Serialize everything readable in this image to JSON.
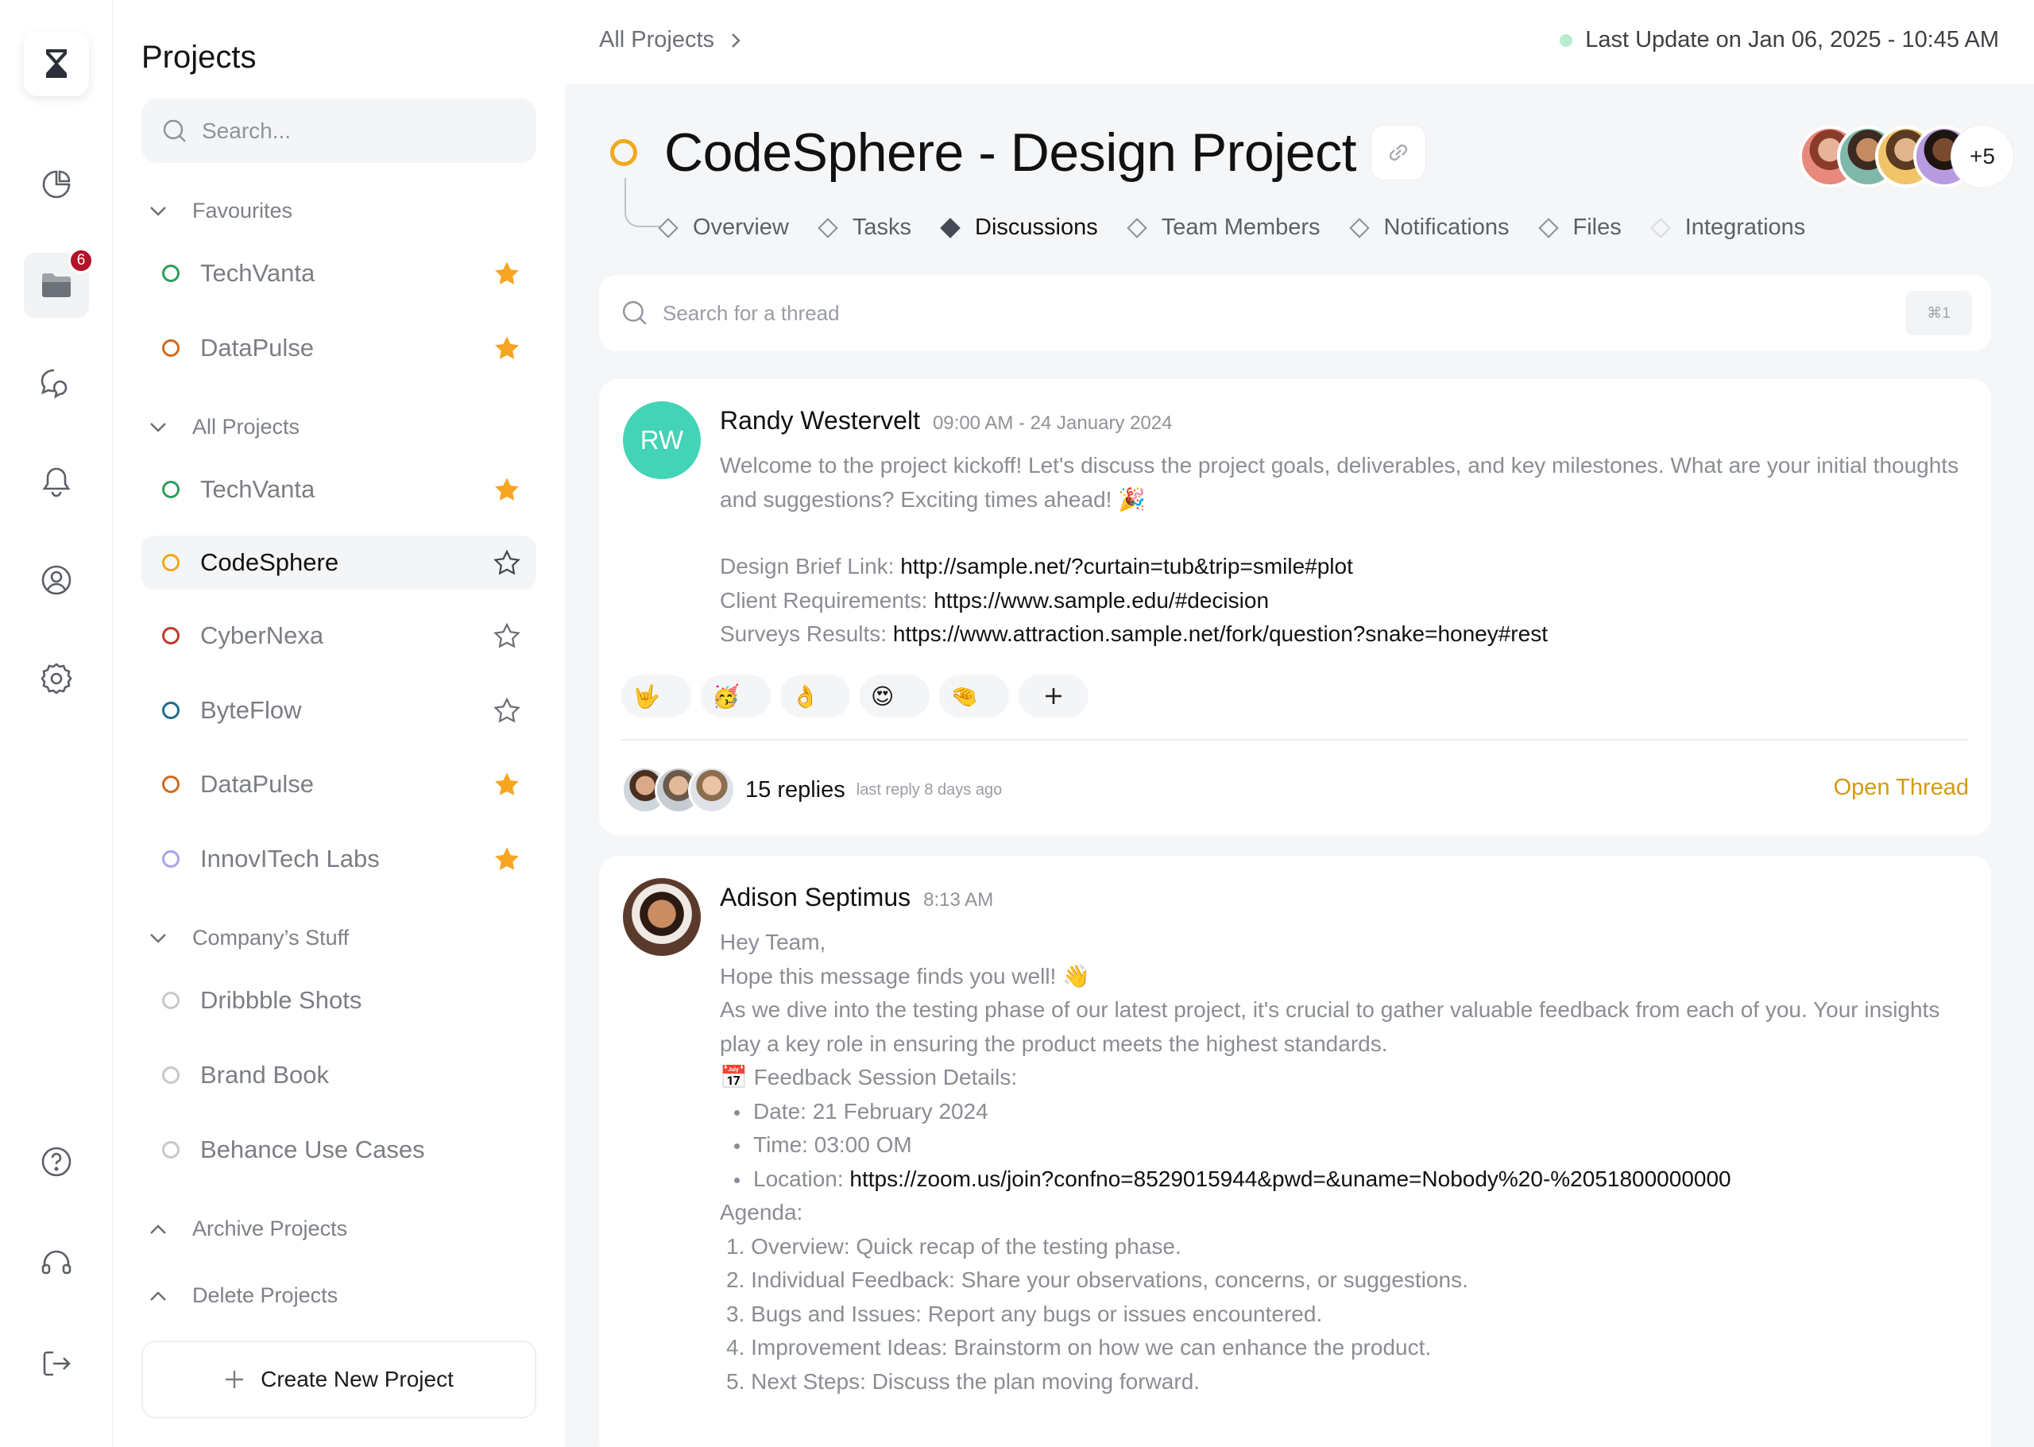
{
  "rail": {
    "notification_badge": "6"
  },
  "sidebar": {
    "title": "Projects",
    "search_placeholder": "Search...",
    "favourites": {
      "label": "Favourites",
      "items": [
        {
          "label": "TechVanta",
          "color": "#2e9e5b",
          "starred": true
        },
        {
          "label": "DataPulse",
          "color": "#d2691e",
          "starred": true
        }
      ]
    },
    "all_projects": {
      "label": "All Projects",
      "items": [
        {
          "label": "TechVanta",
          "color": "#2e9e5b",
          "starred": true
        },
        {
          "label": "CodeSphere",
          "color": "#f0a91a",
          "starred": false
        },
        {
          "label": "CyberNexa",
          "color": "#c0392b",
          "starred": false
        },
        {
          "label": "ByteFlow",
          "color": "#1f6d8a",
          "starred": false
        },
        {
          "label": "DataPulse",
          "color": "#d2691e",
          "starred": true
        },
        {
          "label": "InnovITech Labs",
          "color": "#a9a3f0",
          "starred": true
        }
      ]
    },
    "company_stuff": {
      "label": "Company’s Stuff",
      "items": [
        {
          "label": "Dribbble Shots",
          "color": "#c6c8cc"
        },
        {
          "label": "Brand Book",
          "color": "#c6c8cc"
        },
        {
          "label": "Behance Use Cases",
          "color": "#c6c8cc"
        }
      ]
    },
    "archive_label": "Archive Projects",
    "delete_label": "Delete Projects",
    "create_label": "Create New Project"
  },
  "header": {
    "breadcrumb": "All Projects",
    "last_update": "Last Update on Jan 06, 2025 - 10:45 AM"
  },
  "project": {
    "title": "CodeSphere - Design Project",
    "tabs": [
      "Overview",
      "Tasks",
      "Discussions",
      "Team Members",
      "Notifications",
      "Files",
      "Integrations"
    ],
    "active_tab": "Discussions",
    "members_more": "+5"
  },
  "thread_search": {
    "placeholder": "Search for a thread",
    "shortcut": "⌘1"
  },
  "posts": [
    {
      "initials": "RW",
      "author": "Randy Westervelt",
      "time": "09:00 AM - 24 January 2024",
      "intro": "Welcome to the project kickoff! Let's discuss the project goals, deliverables, and key milestones. What are your initial thoughts and suggestions? Exciting times ahead! 🎉",
      "links": [
        {
          "label": "Design Brief Link:",
          "url": "http://sample.net/?curtain=tub&trip=smile#plot"
        },
        {
          "label": "Client Requirements:",
          "url": "https://www.sample.edu/#decision"
        },
        {
          "label": "Surveys Results:",
          "url": "https://www.attraction.sample.net/fork/question?snake=honey#rest"
        }
      ],
      "reactions": [
        "🤟",
        "🥳",
        "👌",
        "😍",
        "🤏"
      ],
      "replies": "15 replies",
      "last_reply": "last reply 8 days ago",
      "open_thread": "Open Thread"
    },
    {
      "author": "Adison Septimus",
      "time": "8:13 AM",
      "greeting": "Hey Team,",
      "line2": "Hope this message finds you well! 👋",
      "para": "As we dive into the testing phase of our latest project, it's crucial to gather valuable feedback from each of you. Your insights play a key role in ensuring the product meets the highest standards.",
      "session_title": "📅 Feedback Session Details:",
      "details": [
        {
          "text": "Date: 21 February 2024"
        },
        {
          "text": "Time: 03:00 OM"
        },
        {
          "label": "Location:",
          "url": "https://zoom.us/join?confno=8529015944&pwd=&uname=Nobody%20-%2051800000000"
        }
      ],
      "agenda_title": "Agenda:",
      "agenda": [
        "1. Overview: Quick recap of the testing phase.",
        "2. Individual Feedback: Share your observations, concerns, or suggestions.",
        "3. Bugs and Issues: Report any bugs or issues encountered.",
        "4. Improvement Ideas: Brainstorm on how we can enhance the product.",
        "5. Next Steps: Discuss the plan moving forward."
      ]
    }
  ]
}
